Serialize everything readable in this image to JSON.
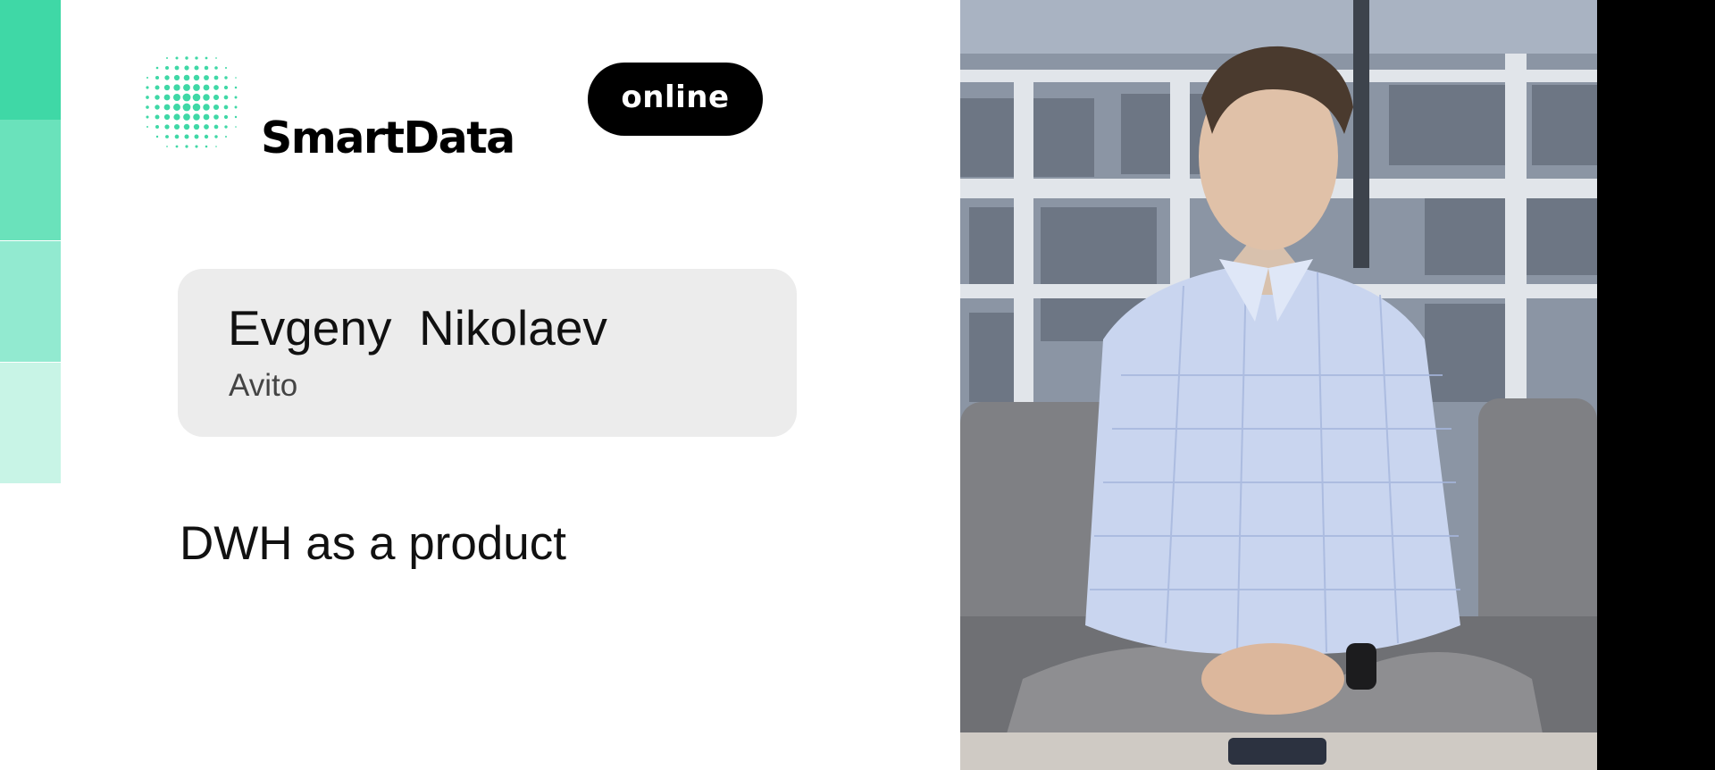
{
  "brand": {
    "name": "SmartData",
    "logo_icon": "halftone-sphere-icon",
    "badge": "online"
  },
  "speaker": {
    "name": "Evgeny  Nikolaev",
    "company": "Avito"
  },
  "talk": {
    "title": "DWH as a product"
  },
  "colors": {
    "accent_1": "#3fd8a6",
    "accent_2": "#6ae2bb",
    "accent_3": "#92ead0",
    "accent_4": "#c8f4e6",
    "card_bg": "#ececec",
    "badge_bg": "#000000"
  }
}
